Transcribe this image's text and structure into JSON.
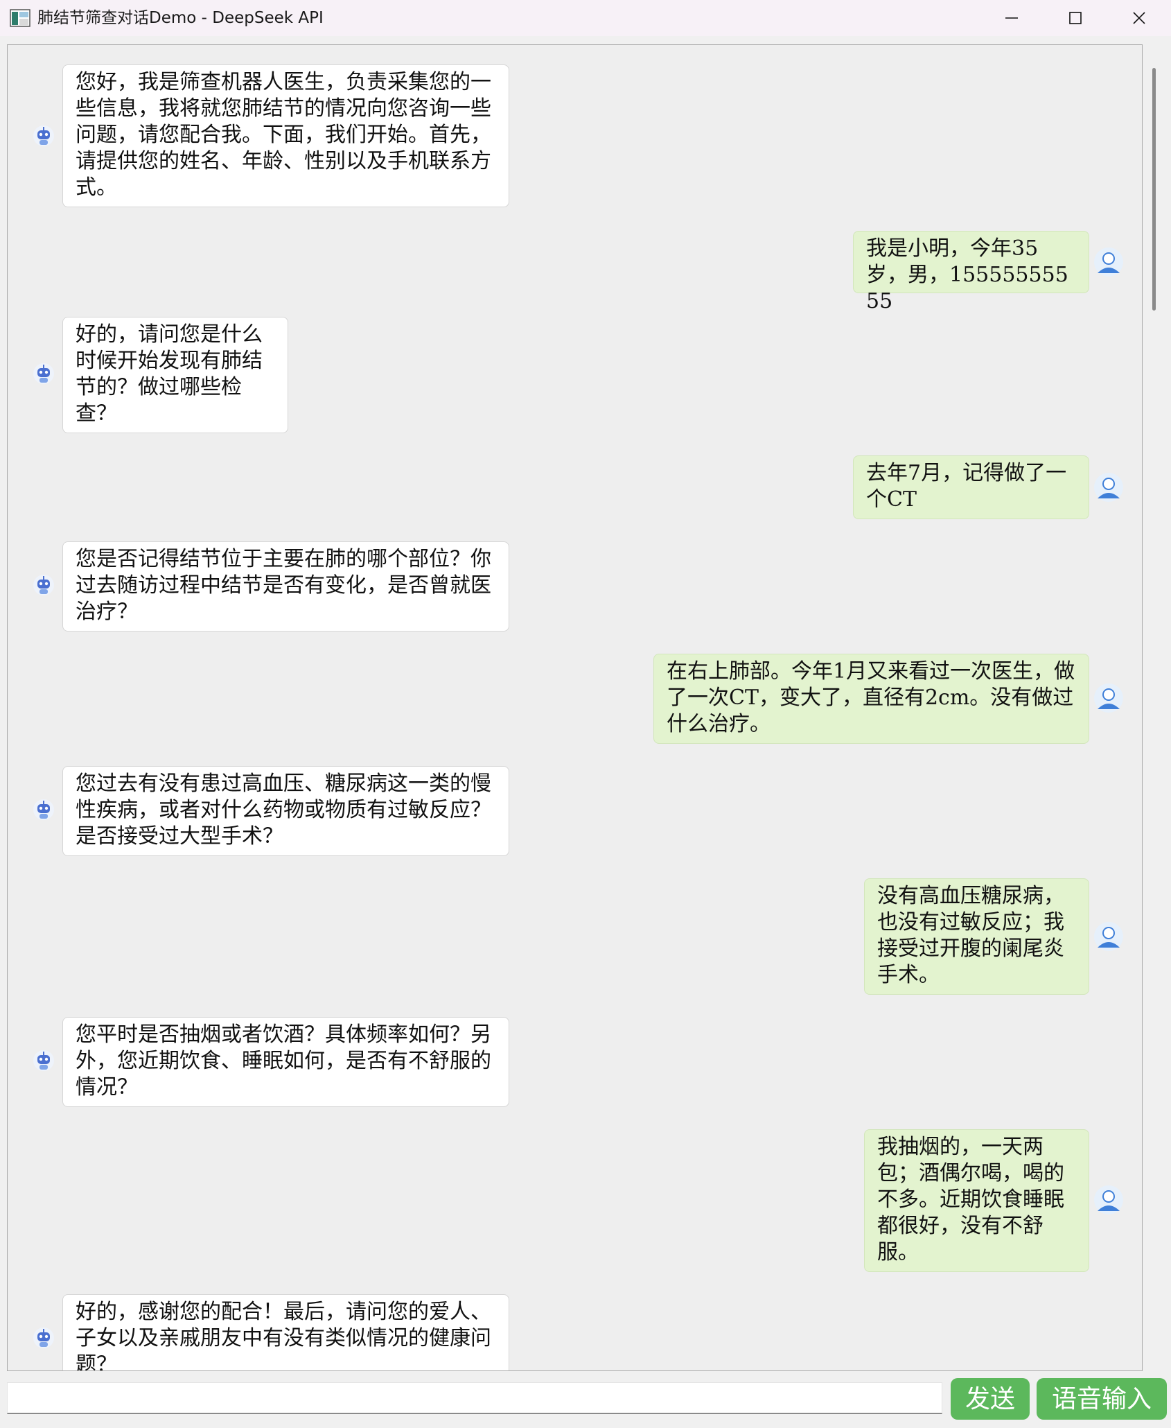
{
  "window": {
    "title": "肺结节筛查对话Demo - DeepSeek API",
    "controls": [
      "minimize-icon",
      "maximize-icon",
      "close-icon"
    ]
  },
  "messages": [
    {
      "role": "bot",
      "text": "您好，我是筛查机器人医生，负责采集您的一些信息，我将就您肺结节的情况向您咨询一些问题，请您配合我。下面，我们开始。首先，请提供您的姓名、年龄、性别以及手机联系方式。"
    },
    {
      "role": "user",
      "text": "我是小明，今年35岁，男，15555555555"
    },
    {
      "role": "bot",
      "text": "好的，请问您是什么时候开始发现有肺结节的？做过哪些检查？"
    },
    {
      "role": "user",
      "text": "去年7月，记得做了一个CT"
    },
    {
      "role": "bot",
      "text": "您是否记得结节位于主要在肺的哪个部位？你过去随访过程中结节是否有变化，是否曾就医治疗？"
    },
    {
      "role": "user",
      "text": "在右上肺部。今年1月又来看过一次医生，做了一次CT，变大了，直径有2cm。没有做过什么治疗。"
    },
    {
      "role": "bot",
      "text": "您过去有没有患过高血压、糖尿病这一类的慢性疾病，或者对什么药物或物质有过敏反应？是否接受过大型手术？"
    },
    {
      "role": "user",
      "text": "没有高血压糖尿病，也没有过敏反应；我接受过开腹的阑尾炎手术。"
    },
    {
      "role": "bot",
      "text": "您平时是否抽烟或者饮酒？具体频率如何？另外，您近期饮食、睡眠如何，是否有不舒服的情况？"
    },
    {
      "role": "user",
      "text": "我抽烟的，一天两包；酒偶尔喝，喝的不多。近期饮食睡眠都很好，没有不舒服。"
    },
    {
      "role": "bot",
      "text": "好的，感谢您的配合！最后，请问您的爱人、子女以及亲戚朋友中有没有类似情况的健康问题？"
    }
  ],
  "input": {
    "value": "",
    "placeholder": ""
  },
  "buttons": {
    "send": "发送",
    "voice": "语音输入"
  },
  "colors": {
    "bot_bubble": "#ffffff",
    "user_bubble": "#e3f3cf",
    "button_green": "#5cb85c"
  }
}
